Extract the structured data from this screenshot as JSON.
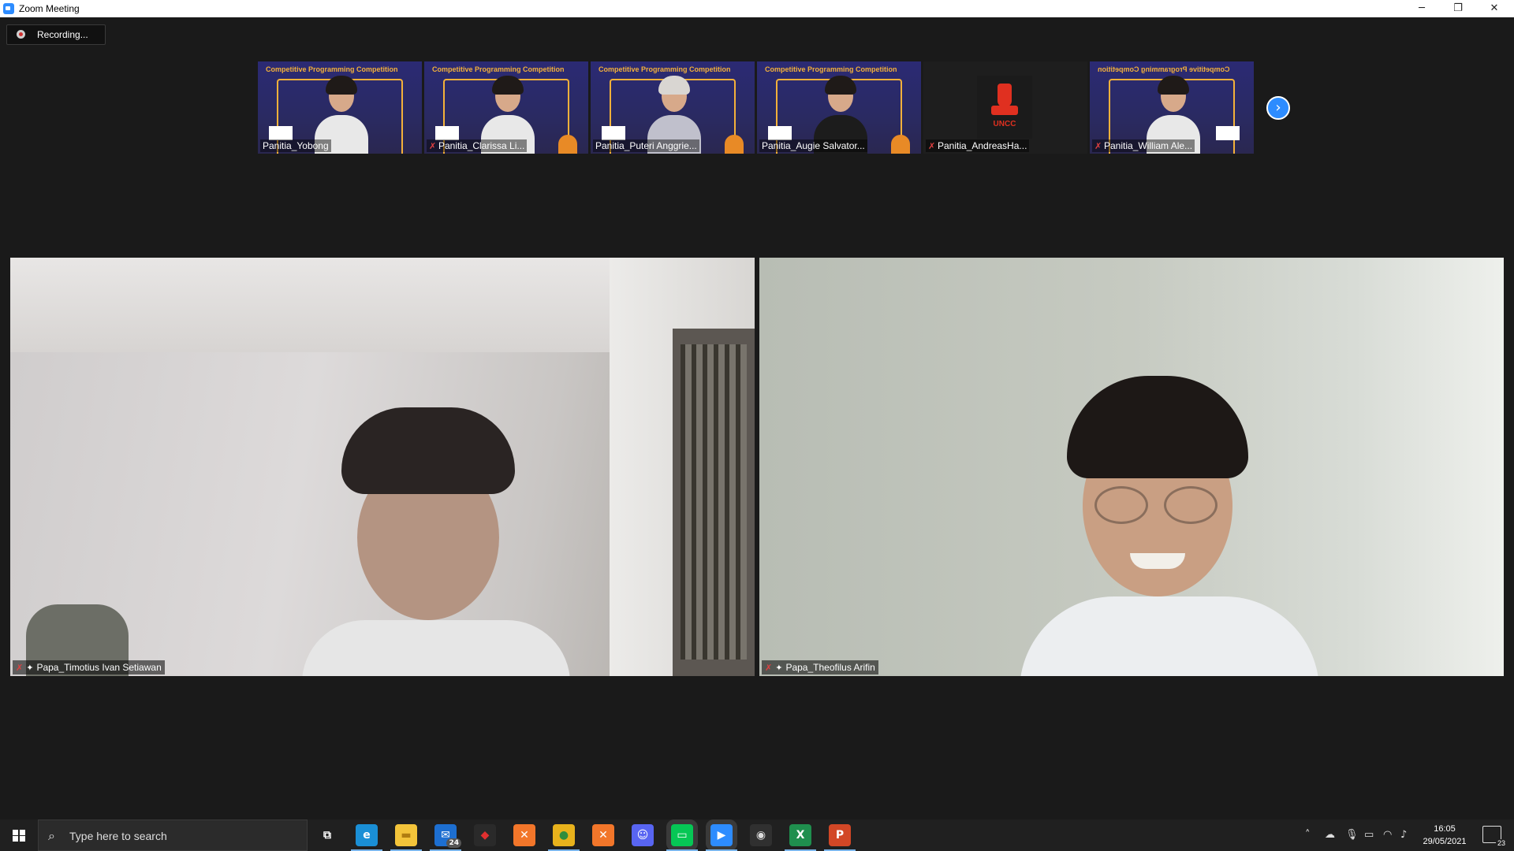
{
  "window": {
    "title": "Zoom Meeting",
    "controls": [
      "─",
      "❐",
      "✕"
    ]
  },
  "recording": {
    "label": "Recording..."
  },
  "gallery": {
    "banner": "Competitive Programming Competition",
    "thumbnails": [
      {
        "name": "Panitia_Yobong",
        "muted": false
      },
      {
        "name": "Panitia_Clarissa Li...",
        "muted": true
      },
      {
        "name": "Panitia_Puteri Anggrie...",
        "muted": false
      },
      {
        "name": "Panitia_Augie Salvator...",
        "muted": false
      },
      {
        "name": "Panitia_AndreasHa...",
        "muted": true,
        "logo_text": "UNCC"
      },
      {
        "name": "Panitia_William Ale...",
        "muted": true
      }
    ],
    "next_icon": "chevron-right-icon"
  },
  "speakers": [
    {
      "name": "Papa_Timotius Ivan Setiawan",
      "muted": true,
      "pinned": true
    },
    {
      "name": "Papa_Theofilus Arifin",
      "muted": true,
      "pinned": true
    }
  ],
  "taskbar": {
    "search_placeholder": "Type here to search",
    "mail_badge": "24",
    "time": "16:05",
    "date": "29/05/2021",
    "notifications": "23",
    "apps": [
      {
        "icon": "task-view-icon",
        "glyph": "⧉",
        "color": "#202020",
        "fg": "#ffffff"
      },
      {
        "icon": "edge-icon",
        "glyph": "e",
        "color": "#1a8fd6",
        "fg": "#ffffff"
      },
      {
        "icon": "file-explorer-icon",
        "glyph": "▬",
        "color": "#f3c43a",
        "fg": "#b07d10"
      },
      {
        "icon": "mail-icon",
        "glyph": "✉",
        "color": "#1d6fd1",
        "fg": "#ffffff"
      },
      {
        "icon": "game-icon",
        "glyph": "◆",
        "color": "#2a2a2a",
        "fg": "#e03030"
      },
      {
        "icon": "xampp-icon",
        "glyph": "✕",
        "color": "#f2762a",
        "fg": "#ffffff"
      },
      {
        "icon": "chrome-icon",
        "glyph": "●",
        "color": "#e8b21c",
        "fg": "#2f8d3c"
      },
      {
        "icon": "xampp-icon-2",
        "glyph": "✕",
        "color": "#f2762a",
        "fg": "#ffffff"
      },
      {
        "icon": "discord-icon",
        "glyph": "☺",
        "color": "#5865f2",
        "fg": "#ffffff"
      },
      {
        "icon": "line-icon",
        "glyph": "▭",
        "color": "#06c755",
        "fg": "#ffffff"
      },
      {
        "icon": "zoom-icon",
        "glyph": "▶",
        "color": "#2d8cff",
        "fg": "#ffffff"
      },
      {
        "icon": "obs-icon",
        "glyph": "◉",
        "color": "#303030",
        "fg": "#dddddd"
      },
      {
        "icon": "excel-icon",
        "glyph": "X",
        "color": "#1f8f4e",
        "fg": "#ffffff"
      },
      {
        "icon": "powerpoint-icon",
        "glyph": "P",
        "color": "#d24726",
        "fg": "#ffffff"
      }
    ]
  }
}
